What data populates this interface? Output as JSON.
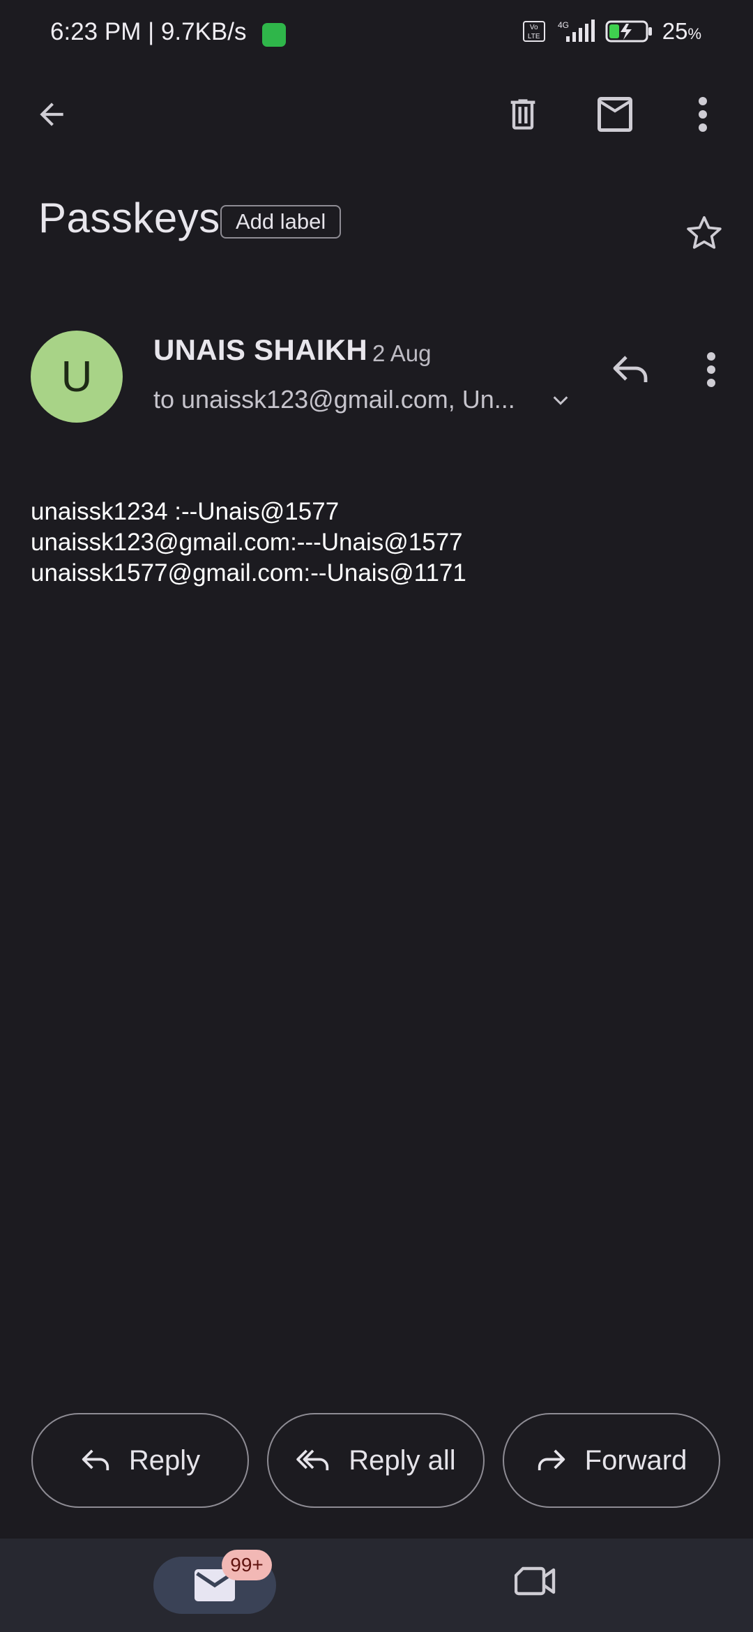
{
  "status_bar": {
    "time_speed": "6:23 PM | 9.7KB/s",
    "volte": "Vo LTE",
    "network": "4G",
    "battery": "25",
    "battery_unit": "%"
  },
  "toolbar": {
    "back_icon": "arrow-left-icon",
    "delete_icon": "trash-icon",
    "mark_unread_icon": "envelope-icon",
    "more_icon": "more-vertical-icon"
  },
  "email": {
    "subject": "Passkeys",
    "add_label": "Add label",
    "starred": false,
    "sender": {
      "initial": "U",
      "name": "UNAIS SHAIKH",
      "date": "2 Aug",
      "recipients": "to unaissk123@gmail.com, Un...",
      "avatar_color": "#a8d387"
    },
    "body_lines": [
      "unaissk1234 :--Unais@1577",
      "unaissk123@gmail.com:---Unais@1577",
      "unaissk1577@gmail.com:--Unais@1171"
    ]
  },
  "actions": {
    "reply": "Reply",
    "reply_all": "Reply all",
    "forward": "Forward"
  },
  "bottom_nav": {
    "mail_badge": "99+",
    "mail_icon": "mail-icon",
    "meet_icon": "video-camera-icon"
  },
  "colors": {
    "background": "#1c1b20",
    "accent_nav": "#3a4256",
    "badge": "#f2b8b5"
  }
}
